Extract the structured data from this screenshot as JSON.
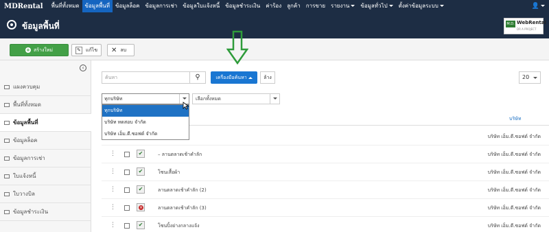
{
  "topnav": {
    "brand": "MDRental",
    "items": [
      {
        "label": "พื้นที่ทั้งหมด"
      },
      {
        "label": "ข้อมูลพื้นที่"
      },
      {
        "label": "ข้อมูลล็อค"
      },
      {
        "label": "ข้อมูลการเช่า"
      },
      {
        "label": "ข้อมูลใบแจ้งหนี้"
      },
      {
        "label": "ข้อมูลชำระเงิน"
      },
      {
        "label": "ค่าร้อง"
      },
      {
        "label": "ลูกค้า"
      },
      {
        "label": "การขาย"
      },
      {
        "label": "รายงาน"
      },
      {
        "label": "ข้อมูลทั่วไป"
      },
      {
        "label": "ตั้งค่าข้อมูลระบบ"
      }
    ],
    "user_icon": "user-icon"
  },
  "header": {
    "title": "ข้อมูลพื้นที่",
    "logo_badge": "M.D.",
    "logo_text": "WebRental",
    "logo_sub": "DR A PROJECT"
  },
  "toolbar": {
    "create_label": "สร้างใหม่",
    "edit_label": "แก้ไข",
    "delete_label": "ลบ"
  },
  "sidebar": {
    "items": [
      {
        "label": "แผงควบคุม"
      },
      {
        "label": "พื้นที่ทั้งหมด"
      },
      {
        "label": "ข้อมูลพื้นที่"
      },
      {
        "label": "ข้อมูลล็อค"
      },
      {
        "label": "ข้อมูลการเช่า"
      },
      {
        "label": "ใบแจ้งหนี้"
      },
      {
        "label": "ใบวางบิล"
      },
      {
        "label": "ข้อมูลชำระเงิน"
      }
    ]
  },
  "search": {
    "placeholder": "ค้นหา",
    "tools_label": "เครื่องมือค้นหา",
    "clear_label": "ล้าง"
  },
  "pager": {
    "per_page": "20"
  },
  "filters": {
    "company_selected": "ทุกบริษัท",
    "company_options": [
      "ทุกบริษัท",
      "บริษัท ทดสอบ จำกัด",
      "บริษัท เอ็ม.ดี.ซอฟต์ จำกัด"
    ],
    "type_selected": "เลือกทั้งหมด"
  },
  "table": {
    "company_header": "บริษัท",
    "rows": [
      {
        "name": "",
        "company": "บริษัท เอ็ม.ดี.ซอฟต์ จำกัด",
        "active": true
      },
      {
        "name": "– ลานตลาดเช้าคำลัก",
        "company": "บริษัท เอ็ม.ดี.ซอฟต์ จำกัด",
        "active": true
      },
      {
        "name": "โซนเสื้อผ้า",
        "company": "บริษัท เอ็ม.ดี.ซอฟต์ จำกัด",
        "active": true
      },
      {
        "name": "ลานตลาดเช้าคำลัก (2)",
        "company": "บริษัท เอ็ม.ดี.ซอฟต์ จำกัด",
        "active": true
      },
      {
        "name": "ลานตลาดเช้าคำลัก (3)",
        "company": "บริษัท เอ็ม.ดี.ซอฟต์ จำกัด",
        "active": false
      },
      {
        "name": "โซนปิ้งย่างกลางแจ้ง",
        "company": "บริษัท เอ็ม.ดี.ซอฟต์ จำกัด",
        "active": true
      }
    ]
  },
  "colors": {
    "nav_bg": "#1d2d44",
    "active_nav": "#1565c0",
    "create_btn": "#43a047",
    "tools_btn": "#1976d2",
    "arrow": "#2e9b3a"
  }
}
